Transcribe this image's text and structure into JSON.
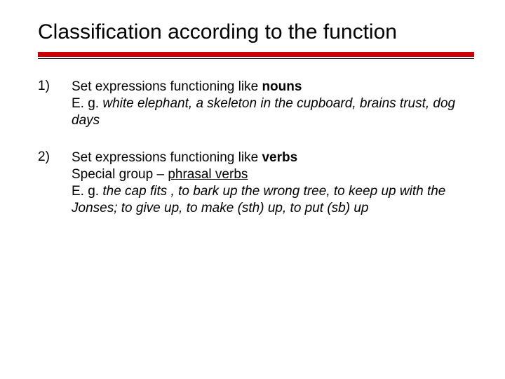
{
  "title": "Classification according to the function",
  "items": [
    {
      "num": "1)",
      "line1_a": "Set expressions functioning  like ",
      "line1_b": "nouns",
      "eg_prefix": "E. g. ",
      "eg_text": "white elephant, a skeleton in the cupboard, brains trust, dog days"
    },
    {
      "num": "2)",
      "line1_a": "Set expressions functioning like ",
      "line1_b": "verbs",
      "line2_a": "Special group – ",
      "line2_b": "phrasal verbs",
      "eg_prefix": "E. g. ",
      "eg_text": "the cap fits , to bark up the wrong tree, to keep up with the Jonses; to give up, to make (sth) up, to put (sb) up"
    }
  ]
}
